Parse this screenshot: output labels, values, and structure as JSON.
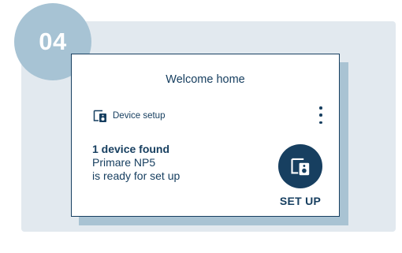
{
  "step": {
    "number": "04"
  },
  "card": {
    "title": "Welcome home",
    "setup_label": "Device setup",
    "menu_icon": "more-vertical-icon",
    "found_title": "1 device found",
    "device_name": "Primare NP5",
    "device_status": "is ready for set up",
    "button_icon": "speaker-device-icon",
    "button_label": "SET UP"
  },
  "colors": {
    "navy": "#173f60",
    "step_circle": "#a7c3d4",
    "backdrop": "#e2e9ef",
    "card_shadow": "#a9c3d3"
  }
}
